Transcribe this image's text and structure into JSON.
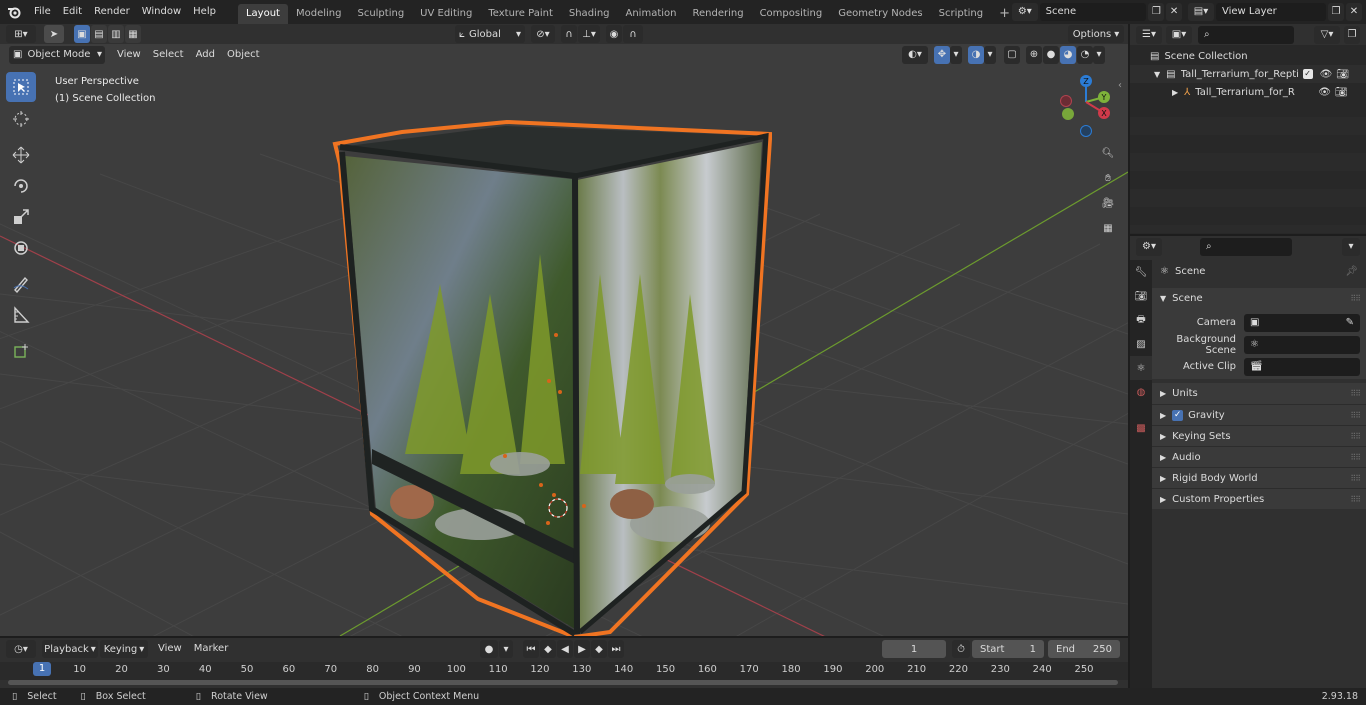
{
  "app": {
    "version": "2.93.18"
  },
  "topbar": {
    "menus": [
      "File",
      "Edit",
      "Render",
      "Window",
      "Help"
    ],
    "workspaces": [
      "Layout",
      "Modeling",
      "Sculpting",
      "UV Editing",
      "Texture Paint",
      "Shading",
      "Animation",
      "Rendering",
      "Compositing",
      "Geometry Nodes",
      "Scripting"
    ],
    "active_workspace": "Layout",
    "add_tab": "+",
    "scene_name": "Scene",
    "view_layer": "View Layer"
  },
  "viewport_header": {
    "mode": "Object Mode",
    "menus": [
      "View",
      "Select",
      "Add",
      "Object"
    ],
    "transform_orientation": "Global",
    "options_label": "Options"
  },
  "viewport": {
    "perspective_label": "User Perspective",
    "collection_label": "(1) Scene Collection",
    "gizmo_axes": {
      "z": "Z",
      "y": "Y",
      "x": "X"
    },
    "colors": {
      "selection_outline": "#f07422",
      "x_axis": "#c0424d",
      "y_axis": "#7eb23a",
      "grid": "#434343",
      "background": "#3d3d3d"
    }
  },
  "outliner": {
    "search_placeholder": "",
    "root": "Scene Collection",
    "items": [
      {
        "label": "Tall_Terrarium_for_Reptiles_w"
      },
      {
        "label": "Tall_Terrarium_for_Reptile"
      }
    ]
  },
  "properties": {
    "title": "Scene",
    "section": "Scene",
    "fields": [
      {
        "label": "Camera"
      },
      {
        "label": "Background Scene"
      },
      {
        "label": "Active Clip"
      }
    ],
    "subpanels": [
      "Units",
      "Gravity",
      "Keying Sets",
      "Audio",
      "Rigid Body World",
      "Custom Properties"
    ],
    "gravity_checked": true
  },
  "timeline": {
    "menus": [
      "Playback",
      "Keying",
      "View",
      "Marker"
    ],
    "current_frame": "1",
    "start_label": "Start",
    "start_value": "1",
    "end_label": "End",
    "end_value": "250",
    "ticks": [
      "1",
      "10",
      "20",
      "30",
      "40",
      "50",
      "60",
      "70",
      "80",
      "90",
      "100",
      "110",
      "120",
      "130",
      "140",
      "150",
      "160",
      "170",
      "180",
      "190",
      "200",
      "210",
      "220",
      "230",
      "240",
      "250"
    ]
  },
  "statusbar": {
    "items": [
      "Select",
      "Box Select",
      "Rotate View",
      "Object Context Menu"
    ]
  }
}
